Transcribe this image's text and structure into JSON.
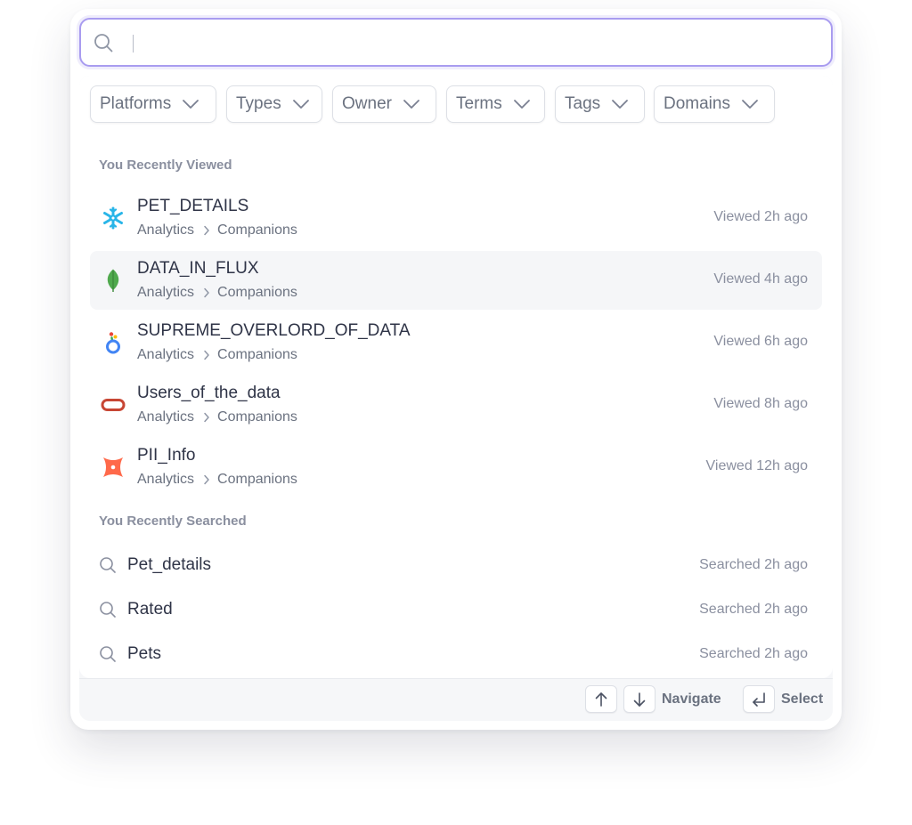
{
  "search": {
    "placeholder": "",
    "value": ""
  },
  "filters": [
    {
      "label": "Platforms"
    },
    {
      "label": "Types"
    },
    {
      "label": "Owner"
    },
    {
      "label": "Terms"
    },
    {
      "label": "Tags"
    },
    {
      "label": "Domains"
    }
  ],
  "recently_viewed": {
    "title": "You Recently Viewed",
    "items": [
      {
        "name": "PET_DETAILS",
        "crumb1": "Analytics",
        "crumb2": "Companions",
        "time": "Viewed 2h ago",
        "platform_icon": "snowflake-icon"
      },
      {
        "name": "DATA_IN_FLUX",
        "crumb1": "Analytics",
        "crumb2": "Companions",
        "time": "Viewed 4h ago",
        "platform_icon": "mongodb-leaf-icon"
      },
      {
        "name": "SUPREME_OVERLORD_OF_DATA",
        "crumb1": "Analytics",
        "crumb2": "Companions",
        "time": "Viewed 6h ago",
        "platform_icon": "looker-icon"
      },
      {
        "name": "Users_of_the_data",
        "crumb1": "Analytics",
        "crumb2": "Companions",
        "time": "Viewed 8h ago",
        "platform_icon": "oracle-icon"
      },
      {
        "name": "PII_Info",
        "crumb1": "Analytics",
        "crumb2": "Companions",
        "time": "Viewed 12h ago",
        "platform_icon": "dbt-icon"
      }
    ]
  },
  "recently_searched": {
    "title": "You Recently Searched",
    "items": [
      {
        "query": "Pet_details",
        "time": "Searched 2h ago"
      },
      {
        "query": "Rated",
        "time": "Searched 2h ago"
      },
      {
        "query": "Pets",
        "time": "Searched 2h ago"
      }
    ]
  },
  "footer": {
    "navigate_label": "Navigate",
    "select_label": "Select"
  },
  "colors": {
    "focus_border": "#a99cf0",
    "snowflake": "#29b5e8",
    "mongodb": "#4fa94d",
    "looker_blue": "#4285f4",
    "oracle": "#c74634",
    "dbt": "#ff694a"
  }
}
